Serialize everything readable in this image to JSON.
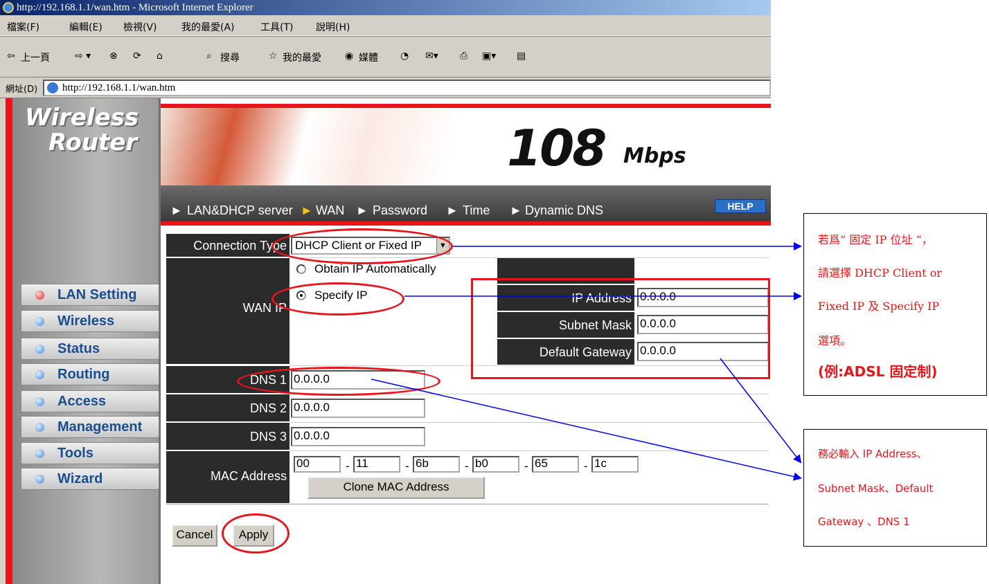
{
  "browser": {
    "title": "http://192.168.1.1/wan.htm - Microsoft Internet Explorer",
    "menu": [
      "檔案(F)",
      "編輯(E)",
      "檢視(V)",
      "我的最愛(A)",
      "工具(T)",
      "說明(H)"
    ],
    "toolbar": [
      "上一頁",
      "搜尋",
      "我的最愛",
      "媒體"
    ],
    "address_label": "網址(D)",
    "address": "http://192.168.1.1/wan.htm"
  },
  "router": {
    "logo_line1": "Wireless",
    "logo_line2": "Router",
    "banner_big": "108",
    "banner_small": "Mbps",
    "topnav": [
      "LAN&DHCP server",
      "WAN",
      "Password",
      "Time",
      "Dynamic DNS"
    ],
    "help": "HELP",
    "sidebar": [
      "LAN Setting",
      "Wireless",
      "Status",
      "Routing",
      "Access",
      "Management",
      "Tools",
      "Wizard"
    ]
  },
  "form": {
    "connection_type_label": "Connection Type",
    "connection_type_value": "DHCP Client or Fixed IP",
    "wan_ip_label": "WAN IP",
    "obtain_auto": "Obtain IP Automatically",
    "specify_ip": "Specify IP",
    "ip_address_label": "IP Address",
    "ip_address": "0.0.0.0",
    "subnet_mask_label": "Subnet Mask",
    "subnet_mask": "0.0.0.0",
    "gateway_label": "Default Gateway",
    "gateway": "0.0.0.0",
    "dns1_label": "DNS 1",
    "dns1": "0.0.0.0",
    "dns2_label": "DNS 2",
    "dns2": "0.0.0.0",
    "dns3_label": "DNS 3",
    "dns3": "0.0.0.0",
    "mac_label": "MAC Address",
    "mac": [
      "00",
      "11",
      "6b",
      "b0",
      "65",
      "1c"
    ],
    "mac_sep": "-",
    "clone_mac": "Clone MAC Address",
    "cancel": "Cancel",
    "apply": "Apply"
  },
  "notes": {
    "note1": [
      "若爲“ 固定 IP 位址 “，",
      "請選擇  DHCP Client or",
      "Fixed IP  及  Specify IP",
      "選項。",
      "(例:ADSL 固定制)"
    ],
    "note2": [
      "務必輸入  IP Address、",
      "Subnet Mask、Default",
      "Gateway   、DNS 1"
    ]
  },
  "colors": {
    "accent_red": "#e8141b",
    "arrow_blue": "#0000ee",
    "label_dark": "#2b2b2b",
    "nav_text": "#1a4e8c"
  }
}
